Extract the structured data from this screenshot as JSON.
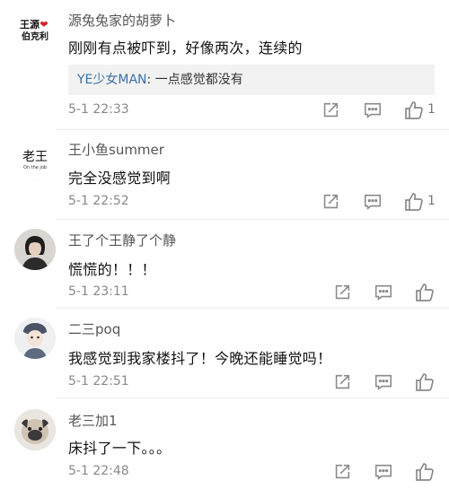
{
  "comments": [
    {
      "username": "源兔兔家的胡萝卜",
      "avatar_text": [
        "王源",
        "伯克利"
      ],
      "avatar_heart": "❤",
      "text": "刚刚有点被吓到，好像两次，连续的",
      "reply": {
        "user": "YE少女MAN",
        "sep": ": ",
        "text": "一点感觉都没有"
      },
      "time": "5-1 22:33",
      "likes": "1"
    },
    {
      "username": "王小鱼summer",
      "avatar_text": [
        "老王",
        "On the job"
      ],
      "text": "完全没感觉到啊",
      "time": "5-1 22:52",
      "likes": "1"
    },
    {
      "username": "王了个王静了个静",
      "text": "慌慌的！！！",
      "time": "5-1 23:11",
      "likes": ""
    },
    {
      "username": "二三poq",
      "text": "我感觉到我家楼抖了！今晚还能睡觉吗！",
      "time": "5-1 22:51",
      "likes": ""
    },
    {
      "username": "老三加1",
      "text": "床抖了一下。。。",
      "time": "5-1 22:48",
      "likes": ""
    }
  ],
  "icons": {
    "share": "share-icon",
    "comment": "comment-icon",
    "like": "thumbs-up-icon"
  },
  "colors": {
    "reply_user": "#3a6fa8",
    "reply_bg": "#f2f2f2",
    "time": "#888888",
    "icon": "#8a8a8a"
  }
}
